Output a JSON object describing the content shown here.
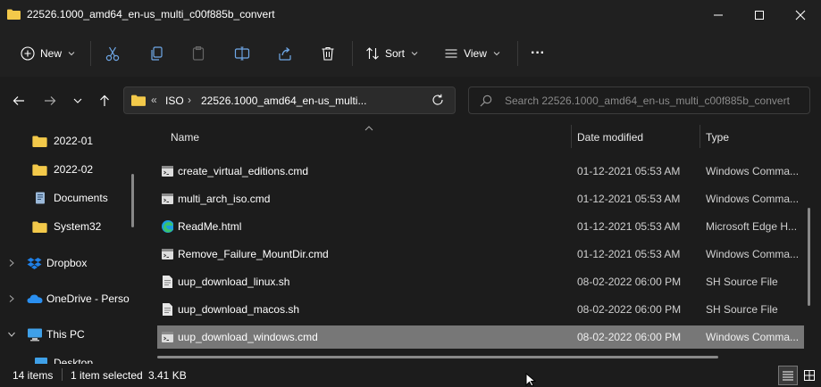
{
  "window": {
    "title": "22526.1000_amd64_en-us_multi_c00f885b_convert",
    "minimize_icon": "minimize-icon",
    "maximize_icon": "maximize-icon",
    "close_icon": "close-icon"
  },
  "toolbar": {
    "new_label": "New",
    "sort_label": "Sort",
    "view_label": "View",
    "more_label": "···"
  },
  "address": {
    "overflow": "«",
    "crumb1": "ISO",
    "sep": "›",
    "crumb2": "22526.1000_amd64_en-us_multi...",
    "search_placeholder": "Search 22526.1000_amd64_en-us_multi_c00f885b_convert"
  },
  "nav": {
    "items": [
      {
        "label": "2022-01",
        "icon": "folder-icon"
      },
      {
        "label": "2022-02",
        "icon": "folder-icon"
      },
      {
        "label": "Documents",
        "icon": "documents-icon"
      },
      {
        "label": "System32",
        "icon": "folder-icon"
      },
      {
        "label": "Dropbox",
        "icon": "dropbox-icon"
      },
      {
        "label": "OneDrive - Perso",
        "icon": "onedrive-icon"
      },
      {
        "label": "This PC",
        "icon": "pc-icon"
      },
      {
        "label": "Desktop",
        "icon": "desktop-icon"
      }
    ]
  },
  "columns": {
    "name": "Name",
    "date": "Date modified",
    "type": "Type"
  },
  "files": [
    {
      "name": "create_virtual_editions.cmd",
      "date": "01-12-2021 05:53 AM",
      "type": "Windows Comma...",
      "icon": "cmd-file-icon"
    },
    {
      "name": "multi_arch_iso.cmd",
      "date": "01-12-2021 05:53 AM",
      "type": "Windows Comma...",
      "icon": "cmd-file-icon"
    },
    {
      "name": "ReadMe.html",
      "date": "01-12-2021 05:53 AM",
      "type": "Microsoft Edge H...",
      "icon": "edge-icon"
    },
    {
      "name": "Remove_Failure_MountDir.cmd",
      "date": "01-12-2021 05:53 AM",
      "type": "Windows Comma...",
      "icon": "cmd-file-icon"
    },
    {
      "name": "uup_download_linux.sh",
      "date": "08-02-2022 06:00 PM",
      "type": "SH Source File",
      "icon": "text-file-icon"
    },
    {
      "name": "uup_download_macos.sh",
      "date": "08-02-2022 06:00 PM",
      "type": "SH Source File",
      "icon": "text-file-icon"
    },
    {
      "name": "uup_download_windows.cmd",
      "date": "08-02-2022 06:00 PM",
      "type": "Windows Comma...",
      "icon": "cmd-file-icon",
      "selected": true
    }
  ],
  "status": {
    "count": "14 items",
    "selected": "1 item selected",
    "size": "3.41 KB"
  },
  "colors": {
    "background": "#1c1c1c",
    "selection": "#777777",
    "folder": "#f3c94a"
  }
}
